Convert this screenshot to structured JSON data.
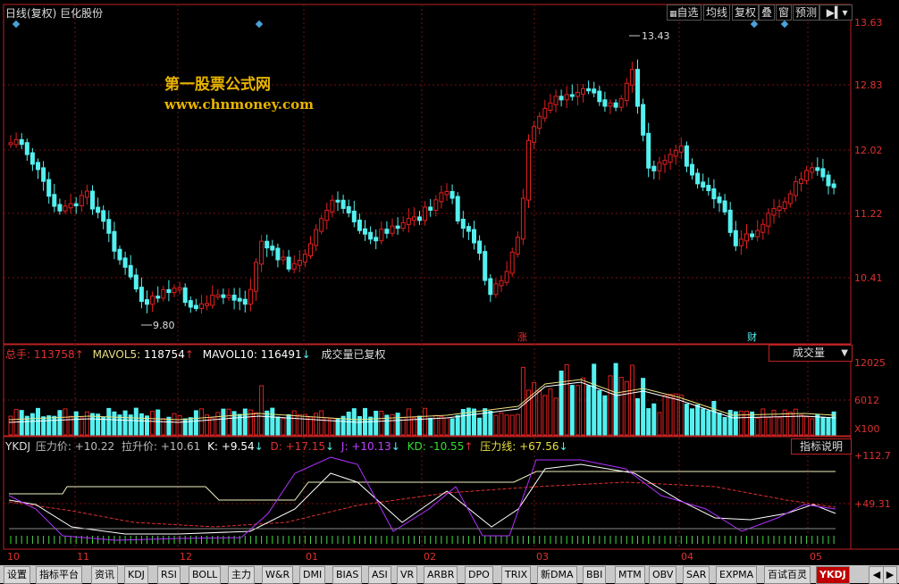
{
  "header": {
    "title": "日线(复权) 巨化股份"
  },
  "toolbar": {
    "zixuan": "自选",
    "junxian": "均线",
    "fuquan": "复权",
    "die": "叠",
    "chuang": "窗",
    "yuce": "预测"
  },
  "watermark": {
    "line1": "第一股票公式网",
    "line2": "www.chnmoney.com"
  },
  "price_panel": {
    "y_labels": [
      "13.63",
      "12.83",
      "12.02",
      "11.22",
      "10.41"
    ],
    "high_mark": "13.43",
    "low_mark": "9.80",
    "marker_zhang": "涨",
    "marker_cai": "财"
  },
  "volume_panel": {
    "zongshou_label": "总手:",
    "zongshou_value": "113758",
    "mavol5_label": "MAVOL5:",
    "mavol5_value": "118754",
    "mavol10_label": "MAVOL10:",
    "mavol10_value": "116491",
    "note": "成交量已复权",
    "selector": "成交量",
    "y_labels": [
      "12025",
      "6012",
      "X100"
    ]
  },
  "indicator_panel": {
    "name": "YKDJ",
    "yali_label": "压力价:",
    "yali_value": "+10.22",
    "lasheng_label": "拉升价:",
    "lasheng_value": "+10.61",
    "k_label": "K:",
    "k_value": "+9.54",
    "d_label": "D:",
    "d_value": "+17.15",
    "j_label": "J:",
    "j_value": "+10.13",
    "kd_label": "KD:",
    "kd_value": "-10.55",
    "ylx_label": "压力线:",
    "ylx_value": "+67.56",
    "help_button": "指标说明",
    "y_labels": [
      "+112.7",
      "+49.31"
    ]
  },
  "x_axis": {
    "labels": [
      "10",
      "11",
      "12",
      "01",
      "02",
      "03",
      "04",
      "05"
    ]
  },
  "tabs": [
    "设置",
    "指标平台",
    "资讯",
    "KDJ",
    "RSI",
    "BOLL",
    "主力",
    "W&R",
    "DMI",
    "BIAS",
    "ASI",
    "VR",
    "ARBR",
    "DPO",
    "TRIX",
    "新DMA",
    "BBI",
    "MTM",
    "OBV",
    "SAR",
    "EXPMA",
    "百试百灵",
    "YKDJ"
  ],
  "colors": {
    "up": "#e02020",
    "down": "#54f0f0",
    "frame": "#b22222",
    "tab_active": "#c00000",
    "watermark": "#e8b400"
  },
  "chart_data": {
    "type": "candlestick",
    "y_range": [
      9.5,
      13.8
    ],
    "high": 13.43,
    "low": 9.8,
    "last_zongshou": 113758,
    "mavol5": 118754,
    "mavol10": 116491
  }
}
